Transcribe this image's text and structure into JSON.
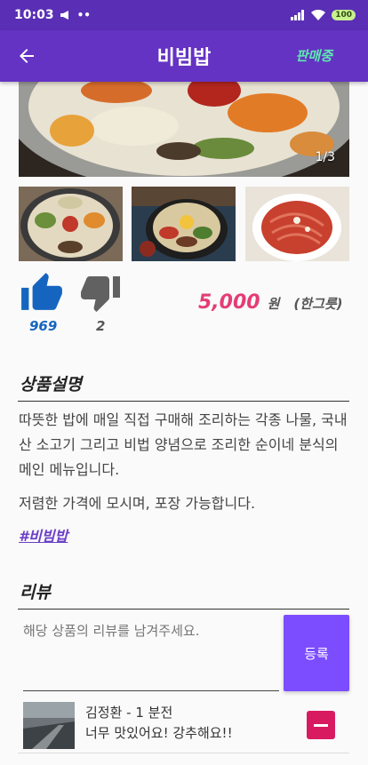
{
  "status_bar": {
    "time": "10:03",
    "battery": "100"
  },
  "app_bar": {
    "title": "비빔밥",
    "status": "판매중"
  },
  "gallery": {
    "counter": "1/3"
  },
  "reactions": {
    "likes": "969",
    "dislikes": "2"
  },
  "price": {
    "amount": "5,000",
    "unit": "원",
    "portion": "(한그릇)"
  },
  "description": {
    "title": "상품설명",
    "paragraph1": "따뜻한 밥에 매일 직접 구매해 조리하는 각종 나물, 국내산 소고기 그리고 비법 양념으로 조리한 순이네 분식의 메인 메뉴입니다.",
    "paragraph2": "저렴한 가격에 모시며, 포장 가능합니다.",
    "tag": "#비빔밥"
  },
  "reviews": {
    "title": "리뷰",
    "input_placeholder": "해당 상품의 리뷰를 남겨주세요.",
    "submit_label": "등록",
    "items": [
      {
        "author": "김정환 - 1 분전",
        "text": "너무 맛있어요! 강추해요!!"
      }
    ]
  },
  "colors": {
    "primary": "#6433c3",
    "status_bar": "#5a2fb5",
    "accent": "#7c4dff",
    "price": "#e43d76",
    "like": "#1565c0",
    "delete": "#d81b60"
  }
}
